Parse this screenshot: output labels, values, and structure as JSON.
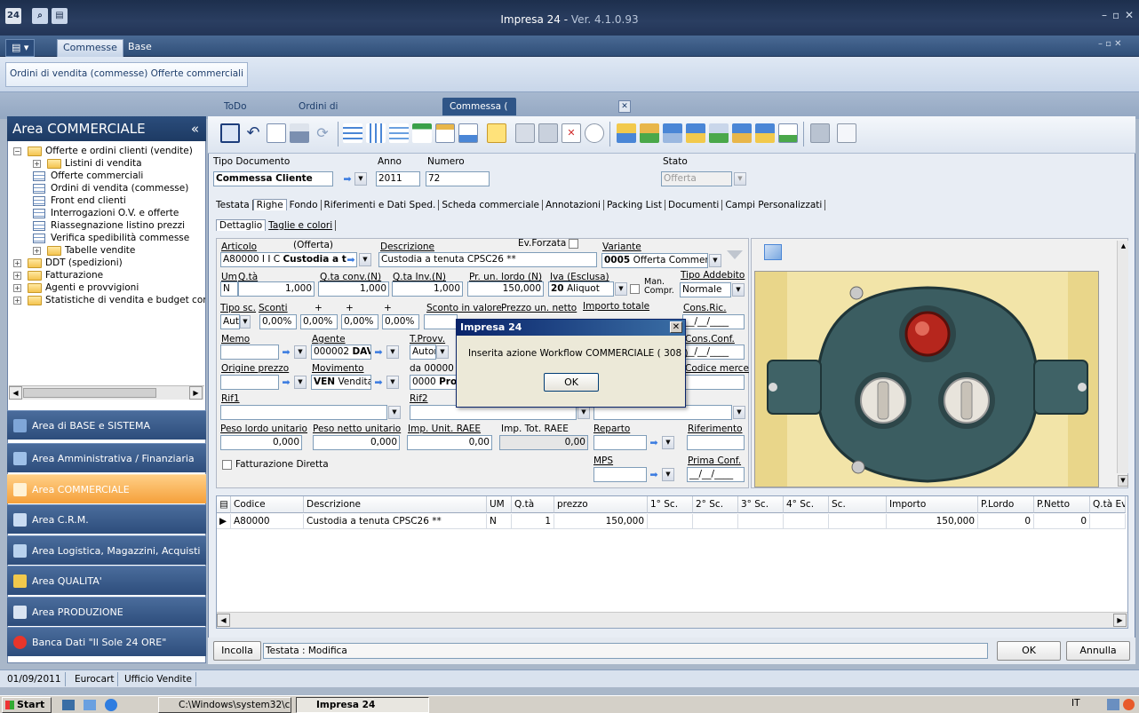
{
  "app": {
    "title": "Impresa 24 -",
    "version": "Ver. 4.1.0.93",
    "icon_text": "24"
  },
  "menu": {
    "app_button": "▤ ▾",
    "tabs": [
      "Commesse",
      "Base"
    ]
  },
  "ribbon": {
    "breadcrumb_1": "Ordini di vendita (commesse)",
    "breadcrumb_2": "Offerte commerciali"
  },
  "doc_tabs": [
    "ToDo List",
    "Ordini di vendita (commesse)",
    "Commessa ( Stabilimento Produzione )"
  ],
  "left": {
    "area_title": "Area COMMERCIALE",
    "collapse": "«",
    "tree": [
      {
        "label": "Offerte e ordini clienti (vendite)",
        "level": 0,
        "exp": "−",
        "icon": "folder"
      },
      {
        "label": "Listini di vendita",
        "level": 1,
        "exp": "+",
        "icon": "folder"
      },
      {
        "label": "Offerte commerciali",
        "level": 1,
        "exp": "",
        "icon": "table"
      },
      {
        "label": "Ordini di vendita (commesse)",
        "level": 1,
        "exp": "",
        "icon": "table"
      },
      {
        "label": "Front end clienti",
        "level": 1,
        "exp": "",
        "icon": "table"
      },
      {
        "label": "Interrogazioni O.V. e offerte",
        "level": 1,
        "exp": "",
        "icon": "table"
      },
      {
        "label": "Riassegnazione listino prezzi",
        "level": 1,
        "exp": "",
        "icon": "table"
      },
      {
        "label": "Verifica spedibilità commesse",
        "level": 1,
        "exp": "",
        "icon": "table"
      },
      {
        "label": "Tabelle vendite",
        "level": 1,
        "exp": "+",
        "icon": "folder"
      },
      {
        "label": "DDT (spedizioni)",
        "level": 0,
        "exp": "+",
        "icon": "folder"
      },
      {
        "label": "Fatturazione",
        "level": 0,
        "exp": "+",
        "icon": "folder"
      },
      {
        "label": "Agenti e provvigioni",
        "level": 0,
        "exp": "+",
        "icon": "folder"
      },
      {
        "label": "Statistiche di vendita e budget comm",
        "level": 0,
        "exp": "+",
        "icon": "folder"
      }
    ],
    "areas": [
      {
        "label": "Area di BASE e SISTEMA",
        "color": "#7fa6d8"
      },
      {
        "label": "Area Amministrativa / Finanziaria",
        "color": "#9ec0e8"
      },
      {
        "label": "Area COMMERCIALE",
        "color": "#fff2d6",
        "selected": true
      },
      {
        "label": "Area C.R.M.",
        "color": "#c9dbf2"
      },
      {
        "label": "Area Logistica, Magazzini, Acquisti",
        "color": "#b9d2ee"
      },
      {
        "label": "Area QUALITA'",
        "color": "#f2c94c"
      },
      {
        "label": "Area PRODUZIONE",
        "color": "#d9e4f2"
      },
      {
        "label": "Banca Dati \"Il Sole 24 ORE\"",
        "color": "#e8352a"
      }
    ]
  },
  "header": {
    "tipo_documento_label": "Tipo Documento",
    "tipo_documento": "Commessa Cliente",
    "anno_label": "Anno",
    "anno": "2011",
    "numero_label": "Numero",
    "numero": "72",
    "stato_label": "Stato",
    "stato": "Offerta"
  },
  "form_tabs": [
    "Testata",
    "Righe",
    "Fondo",
    "Riferimenti e Dati Sped.",
    "Scheda commerciale",
    "Annotazioni",
    "Packing List",
    "Documenti",
    "Campi Personalizzati"
  ],
  "sub_tabs": [
    "Dettaglio",
    "Taglie e colori"
  ],
  "form": {
    "articolo_label": "Articolo",
    "offerta_label": "(Offerta)",
    "articolo_code": "A80000 I I C",
    "articolo_name": "Custodia a t",
    "descrizione_label": "Descrizione",
    "descrizione": "Custodia a tenuta CPSC26 **",
    "ev_forzata_label": "Ev.Forzata",
    "variante_label": "Variante",
    "variante_code": "0005",
    "variante": "Offerta Commer",
    "um_label": "Um",
    "um": "N",
    "qta_label": "Q.tà",
    "qta": "1,000",
    "qta_conv_label": "Q.ta conv.(N)",
    "qta_conv": "1,000",
    "qta_inv_label": "Q.ta Inv.(N)",
    "qta_inv": "1,000",
    "pr_lordo_label": "Pr. un. lordo (N)",
    "pr_lordo": "150,000",
    "iva_label": "Iva (Esclusa)",
    "iva_code": "20",
    "iva": "Aliquot",
    "man_compr_label_1": "Man.",
    "man_compr_label_2": "Compr.",
    "tipo_addebito_label": "Tipo Addebito",
    "tipo_addebito": "Normale",
    "tipo_sc_label": "Tipo sc.",
    "tipo_sc": "Aut",
    "sconti_label": "Sconti",
    "plus": "+",
    "sconto1": "0,00%",
    "sconto2": "0,00%",
    "sconto3": "0,00%",
    "sconto4": "0,00%",
    "sconto_valore_label": "Sconto in valore",
    "prezzo_netto_label": "Prezzo un. netto",
    "importo_totale_label": "Importo totale",
    "cons_ric_label": "Cons.Ric.",
    "cons_ric": "__/__/____",
    "memo_label": "Memo",
    "agente_label": "Agente",
    "agente_code": "000002",
    "agente": "DAV",
    "tprovv_label": "T.Provv.",
    "tprovv": "Autor",
    "cons_conf_label": "Cons.Conf.",
    "cons_conf": "__/__/____",
    "origine_prezzo_label": "Origine prezzo",
    "movimento_label": "Movimento",
    "movimento_code": "VEN",
    "movimento": "Vendita",
    "da_label": "da 00000",
    "da_code": "0000",
    "da": "Proc",
    "codice_merce_label": "Codice merce",
    "rif1_label": "Rif1",
    "rif2_label": "Rif2",
    "peso_lordo_label": "Peso lordo unitario",
    "peso_lordo": "0,000",
    "peso_netto_label": "Peso netto unitario",
    "peso_netto": "0,000",
    "imp_raee_label": "Imp. Unit. RAEE",
    "imp_raee": "0,00",
    "imp_tot_raee_label": "Imp. Tot. RAEE",
    "imp_tot_raee": "0,00",
    "reparto_label": "Reparto",
    "riferimento_label": "Riferimento",
    "fatturazione_diretta_label": "Fatturazione Diretta",
    "mps_label": "MPS",
    "prima_conf_label": "Prima Conf.",
    "prima_conf": "__/__/____"
  },
  "grid": {
    "columns": [
      "Codice",
      "Descrizione",
      "UM",
      "Q.tà",
      "prezzo",
      "1° Sc.",
      "2° Sc.",
      "3° Sc.",
      "4° Sc.",
      "Sc.",
      "Importo",
      "P.Lordo",
      "P.Netto",
      "Q.tà Ev"
    ],
    "rows": [
      [
        "A80000",
        "Custodia a tenuta CPSC26 **",
        "N",
        "1",
        "150,000",
        "",
        "",
        "",
        "",
        "",
        "150,000",
        "0",
        "0",
        ""
      ]
    ]
  },
  "bottom": {
    "incolla": "Incolla",
    "status": "Testata : Modifica",
    "ok": "OK",
    "annulla": "Annulla"
  },
  "dialog": {
    "title": "Impresa 24",
    "close": "✕",
    "message": "Inserita azione Workflow COMMERCIALE ( 308 )",
    "ok": "OK"
  },
  "statusbar": [
    "01/09/2011",
    "Eurocart",
    "Ufficio Vendite"
  ],
  "taskbar": {
    "start": "Start",
    "task1": "C:\\Windows\\system32\\c...",
    "task2": "Impresa 24",
    "lang": "IT"
  }
}
